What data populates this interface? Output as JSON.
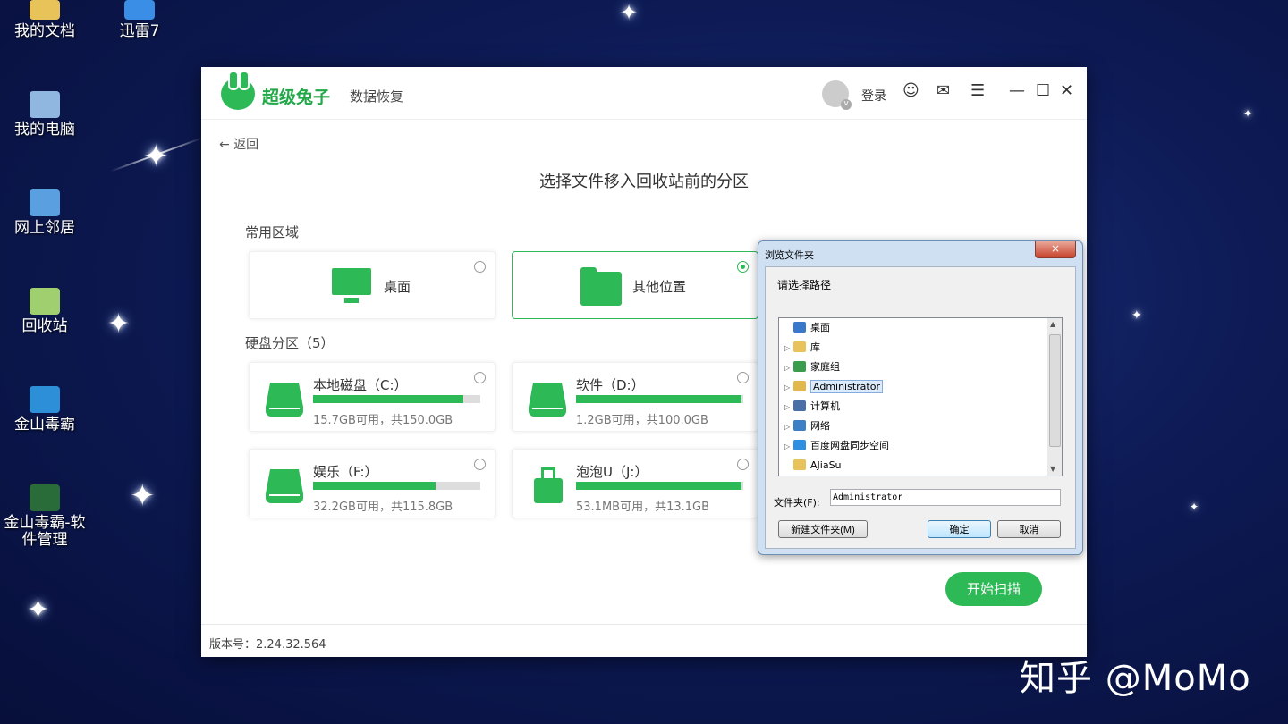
{
  "desktop": {
    "icons": [
      {
        "label": "我的文档",
        "icon": "documents-icon"
      },
      {
        "label": "迅雷7",
        "icon": "thunder-icon"
      },
      {
        "label": "我的电脑",
        "icon": "computer-icon"
      },
      {
        "label": "网上邻居",
        "icon": "network-icon"
      },
      {
        "label": "回收站",
        "icon": "recycle-bin-icon"
      },
      {
        "label": "金山毒霸",
        "icon": "antivirus-icon"
      },
      {
        "label": "金山毒霸-软件管理",
        "icon": "software-manager-icon"
      }
    ]
  },
  "app": {
    "brand_name": "超级兔子",
    "brand_sub": "数据恢复",
    "login_label": "登录",
    "back_label": "返回",
    "page_title": "选择文件移入回收站前的分区",
    "common_section": "常用区域",
    "common_cards": [
      {
        "label": "桌面",
        "icon": "monitor-icon",
        "selected": false
      },
      {
        "label": "其他位置",
        "icon": "folder-icon",
        "selected": true
      }
    ],
    "disk_section": "硬盘分区（5）",
    "disks": [
      {
        "name": "本地磁盘（C:）",
        "info": "15.7GB可用，共150.0GB",
        "used_fraction": 0.9
      },
      {
        "name": "软件（D:）",
        "info": "1.2GB可用，共100.0GB",
        "used_fraction": 0.99
      },
      {
        "name": "娱乐（F:）",
        "info": "32.2GB可用，共115.8GB",
        "used_fraction": 0.73
      },
      {
        "name": "泡泡U（J:）",
        "info": "53.1MB可用，共13.1GB",
        "used_fraction": 0.99
      }
    ],
    "scan_label": "开始扫描",
    "version": "版本号：2.24.32.564",
    "accent": "#2db955"
  },
  "dialog": {
    "title": "浏览文件夹",
    "close": "×",
    "prompt": "请选择路径",
    "tree": [
      {
        "label": "桌面",
        "arrow": "",
        "color": "#3a78c9"
      },
      {
        "label": "库",
        "arrow": "▷",
        "color": "#e8c25a"
      },
      {
        "label": "家庭组",
        "arrow": "▷",
        "color": "#3a9d4d"
      },
      {
        "label": "Administrator",
        "arrow": "▷",
        "color": "#e0b84c",
        "selected": true
      },
      {
        "label": "计算机",
        "arrow": "▷",
        "color": "#4a6fa8"
      },
      {
        "label": "网络",
        "arrow": "▷",
        "color": "#3c7fc4"
      },
      {
        "label": "百度网盘同步空间",
        "arrow": "▷",
        "color": "#2e8fe0"
      },
      {
        "label": "AJiaSu",
        "arrow": "",
        "color": "#e8c25a"
      }
    ],
    "folder_label": "文件夹(F):",
    "folder_value": "Administrator",
    "new_folder": "新建文件夹(M)",
    "ok": "确定",
    "cancel": "取消"
  },
  "watermark": "知乎 @MoMo"
}
